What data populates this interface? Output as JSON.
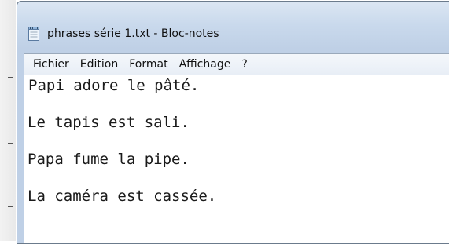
{
  "window": {
    "title": "phrases série 1.txt - Bloc-notes",
    "icon": "notepad-icon"
  },
  "menu": {
    "items": [
      {
        "label": "Fichier"
      },
      {
        "label": "Edition"
      },
      {
        "label": "Format"
      },
      {
        "label": "Affichage"
      },
      {
        "label": "?"
      }
    ]
  },
  "editor": {
    "lines": [
      "Papi adore le pâté.",
      "Le tapis est sali.",
      "Papa fume la pipe.",
      "La caméra est cassée."
    ]
  },
  "colors": {
    "titlebar": "#c9d9ec",
    "window_border": "#6b7b8c",
    "text": "#1a1a1a",
    "background": "#ffffff"
  }
}
